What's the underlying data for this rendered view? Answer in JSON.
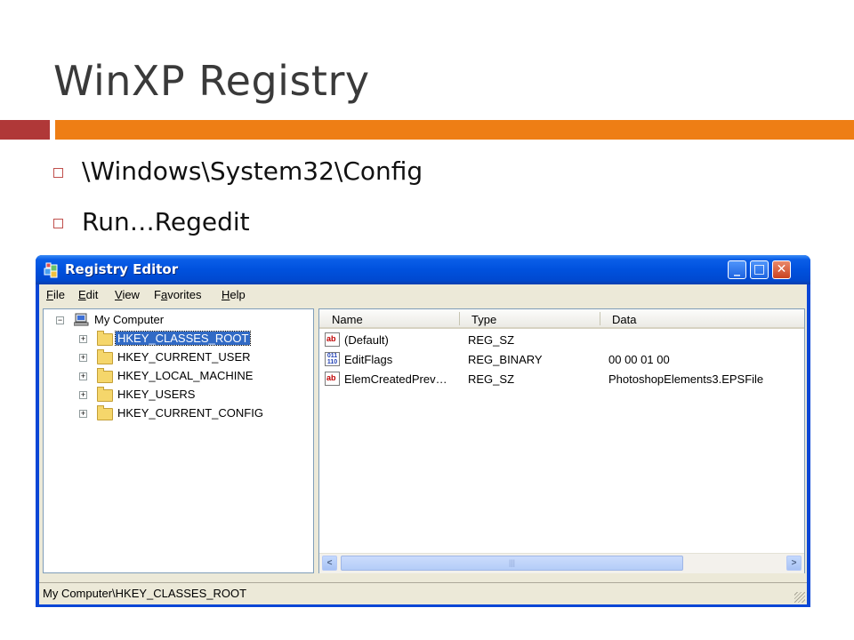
{
  "slide": {
    "title": "WinXP Registry",
    "bullets": [
      "\\Windows\\System32\\Config",
      "Run…Regedit"
    ]
  },
  "window": {
    "title": "Registry Editor",
    "menu": [
      {
        "label": "File",
        "accel": "F",
        "rest": "ile"
      },
      {
        "label": "Edit",
        "accel": "E",
        "rest": "dit"
      },
      {
        "label": "View",
        "accel": "V",
        "rest": "iew"
      },
      {
        "label": "Favorites",
        "accel": "a",
        "first": "F",
        "rest": "vorites"
      },
      {
        "label": "Help",
        "accel": "H",
        "rest": "elp"
      }
    ],
    "tree": {
      "root": "My Computer",
      "keys": [
        "HKEY_CLASSES_ROOT",
        "HKEY_CURRENT_USER",
        "HKEY_LOCAL_MACHINE",
        "HKEY_USERS",
        "HKEY_CURRENT_CONFIG"
      ],
      "selected": "HKEY_CLASSES_ROOT"
    },
    "list": {
      "columns": [
        "Name",
        "Type",
        "Data"
      ],
      "rows": [
        {
          "icon": "string-value-icon",
          "name": "(Default)",
          "type": "REG_SZ",
          "data": ""
        },
        {
          "icon": "binary-value-icon",
          "name": "EditFlags",
          "type": "REG_BINARY",
          "data": "00 00 01 00"
        },
        {
          "icon": "string-value-icon",
          "name": "ElemCreatedPrev…",
          "type": "REG_SZ",
          "data": "PhotoshopElements3.EPSFile"
        }
      ]
    },
    "status": "My Computer\\HKEY_CLASSES_ROOT"
  },
  "colors": {
    "accent_red": "#b03838",
    "accent_orange": "#ee7e15",
    "titlebar_blue": "#0051dd",
    "selection_blue": "#316ac5"
  }
}
